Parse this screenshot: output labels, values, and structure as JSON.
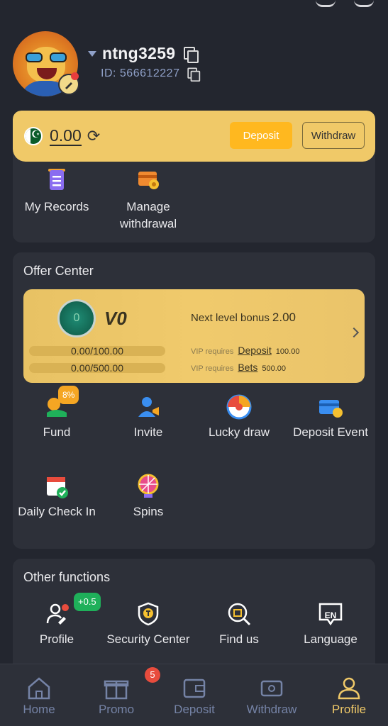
{
  "header": {
    "username": "ntng3259",
    "id_text": "ID: 566612227"
  },
  "wallet": {
    "balance": "0.00",
    "deposit_label": "Deposit",
    "withdraw_label": "Withdraw",
    "links": [
      {
        "label": "My Records",
        "icon": "records-icon"
      },
      {
        "label": "Manage withdrawal",
        "icon": "manage-withdrawal-icon"
      }
    ]
  },
  "offer_center": {
    "title": "Offer Center",
    "vip": {
      "medal_text": "0",
      "level": "V0",
      "next_level_label": "Next level bonus",
      "next_level_value": "2.00",
      "deposit_progress": "0.00/100.00",
      "bets_progress": "0.00/500.00",
      "requires_label": "VIP requires",
      "deposit_link": "Deposit",
      "deposit_req": "100.00",
      "bets_link": "Bets",
      "bets_req": "500.00"
    },
    "items": [
      {
        "label": "Fund",
        "badge": "8%",
        "icon": "fund-icon"
      },
      {
        "label": "Invite",
        "icon": "invite-icon"
      },
      {
        "label": "Lucky draw",
        "icon": "lucky-draw-icon"
      },
      {
        "label": "Deposit Event",
        "icon": "deposit-event-icon"
      },
      {
        "label": "Daily Check In",
        "icon": "daily-check-in-icon"
      },
      {
        "label": "Spins",
        "icon": "spins-icon"
      }
    ]
  },
  "other_functions": {
    "title": "Other functions",
    "items": [
      {
        "label": "Profile",
        "badge": "+0.5",
        "icon": "profile-edit-icon"
      },
      {
        "label": "Security Center",
        "icon": "security-icon"
      },
      {
        "label": "Find us",
        "icon": "find-us-icon"
      },
      {
        "label": "Language",
        "icon": "language-icon",
        "icon_text": "EN"
      }
    ]
  },
  "bottom_nav": {
    "items": [
      {
        "label": "Home",
        "icon": "home-icon"
      },
      {
        "label": "Promo",
        "icon": "gift-icon",
        "badge": "5"
      },
      {
        "label": "Deposit",
        "icon": "wallet-icon"
      },
      {
        "label": "Withdraw",
        "icon": "withdraw-icon"
      },
      {
        "label": "Profile",
        "icon": "user-icon",
        "active": true
      }
    ]
  },
  "colors": {
    "background": "#23262f",
    "card": "#2d3039",
    "gold": "#f0c968",
    "accent_orange": "#ffb81f",
    "nav_inactive": "#7583a6"
  }
}
